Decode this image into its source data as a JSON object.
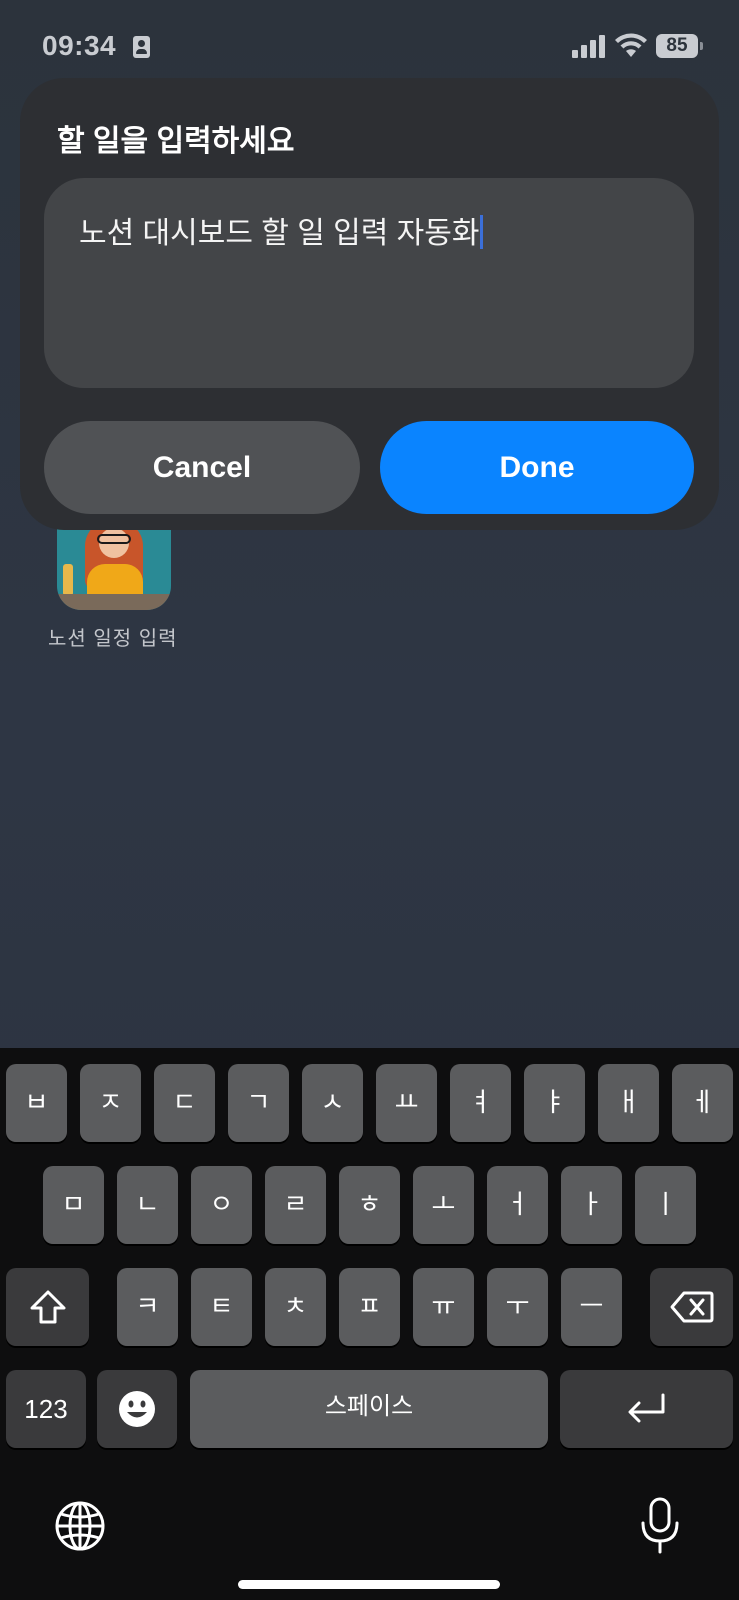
{
  "status_bar": {
    "time": "09:34",
    "battery": "85"
  },
  "dialog": {
    "title": "할 일을 입력하세요",
    "input_value": "노션 대시보드 할 일 입력 자동화",
    "cancel_label": "Cancel",
    "done_label": "Done",
    "accent_color": "#0a84ff"
  },
  "home": {
    "app_label": "노션 일정 입력"
  },
  "keyboard": {
    "row1": [
      "ㅂ",
      "ㅈ",
      "ㄷ",
      "ㄱ",
      "ㅅ",
      "ㅛ",
      "ㅕ",
      "ㅑ",
      "ㅐ",
      "ㅔ"
    ],
    "row2": [
      "ㅁ",
      "ㄴ",
      "ㅇ",
      "ㄹ",
      "ㅎ",
      "ㅗ",
      "ㅓ",
      "ㅏ",
      "ㅣ"
    ],
    "row3": [
      "ㅋ",
      "ㅌ",
      "ㅊ",
      "ㅍ",
      "ㅠ",
      "ㅜ",
      "ㅡ"
    ],
    "numbers_label": "123",
    "space_label": "스페이스",
    "icons": [
      "shift-icon",
      "backspace-icon",
      "emoji-icon",
      "return-icon",
      "globe-icon",
      "mic-icon"
    ]
  }
}
